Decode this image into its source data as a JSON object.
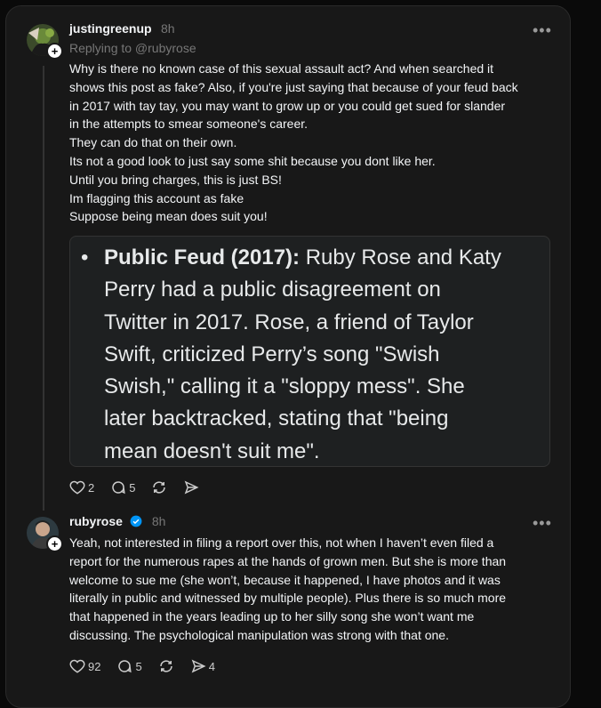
{
  "post1": {
    "username": "justingreenup",
    "time": "8h",
    "replying_to": "Replying to @rubyrose",
    "lines": [
      "Why is there no known case of this sexual assault act? And when searched it",
      "shows this post as fake? Also, if you're just saying that because of your feud back",
      "in 2017 with tay tay, you may want to grow up or you could get sued for slander",
      "in the attempts to smear someone's career.",
      "They can do that on their own.",
      "Its not a good look to just say some shit because you dont like her.",
      "Until you bring charges, this is just BS!",
      "Im flagging this account as fake",
      "Suppose being mean does suit you!"
    ],
    "quote": {
      "bold": "Public Feud (2017):",
      "lines": [
        " Ruby Rose and Katy",
        "Perry had a public disagreement on",
        "Twitter in 2017. Rose, a friend of Taylor",
        "Swift, criticized Perry’s song \"Swish",
        "Swish,\" calling it a \"sloppy mess\". She",
        "later backtracked, stating that \"being",
        "mean doesn't suit me\"."
      ]
    },
    "likes": "2",
    "comments": "5"
  },
  "post2": {
    "username": "rubyrose",
    "time": "8h",
    "lines": [
      "Yeah, not interested in filing a report over this, not when I haven’t even filed a",
      "report for the numerous rapes at the hands of grown men. But she is more than",
      "welcome to sue me (she won’t, because it happened, I have photos and it was",
      "literally in public and witnessed by multiple people). Plus there is so much more",
      "that happened in the years leading up to her silly song she won’t want me",
      "discussing. The psychological manipulation was strong with that one."
    ],
    "likes": "92",
    "comments": "5",
    "shares": "4"
  },
  "colors": {
    "background": "#181818",
    "verified": "#0095f6",
    "muted": "#777777"
  }
}
